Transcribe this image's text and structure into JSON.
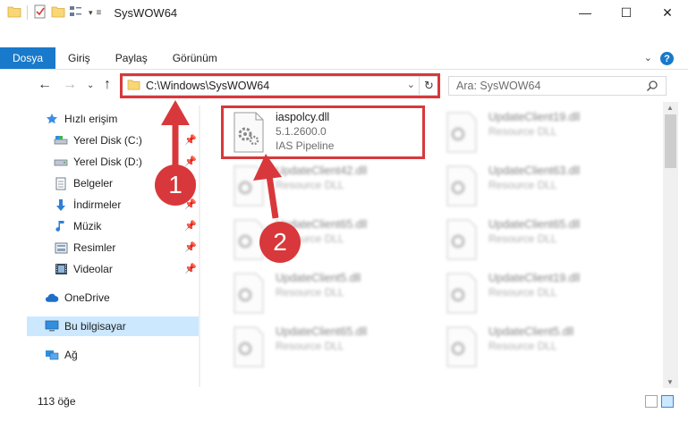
{
  "window": {
    "title": "SysWOW64",
    "controls": [
      "—",
      "☐",
      "✕"
    ]
  },
  "ribbon": {
    "tabs": [
      {
        "label": "Dosya",
        "active": true
      },
      {
        "label": "Giriş"
      },
      {
        "label": "Paylaş"
      },
      {
        "label": "Görünüm"
      }
    ],
    "help": "?"
  },
  "navbar": {
    "address": "C:\\Windows\\SysWOW64",
    "search_placeholder": "Ara: SysWOW64"
  },
  "sidebar": {
    "items": [
      {
        "label": "Hızlı erişim",
        "icon": "star-icon"
      },
      {
        "label": "Yerel Disk (C:)",
        "icon": "drive-icon",
        "pinned": true
      },
      {
        "label": "Yerel Disk (D:)",
        "icon": "drive-icon",
        "pinned": true
      },
      {
        "label": "Belgeler",
        "icon": "document-icon",
        "pinned": true
      },
      {
        "label": "İndirmeler",
        "icon": "download-icon",
        "pinned": true
      },
      {
        "label": "Müzik",
        "icon": "music-icon",
        "pinned": true
      },
      {
        "label": "Resimler",
        "icon": "pictures-icon",
        "pinned": true
      },
      {
        "label": "Videolar",
        "icon": "video-icon",
        "pinned": true
      },
      {
        "label": "OneDrive",
        "icon": "cloud-icon"
      },
      {
        "label": "Bu bilgisayar",
        "icon": "computer-icon",
        "selected": true
      },
      {
        "label": "Ağ",
        "icon": "network-icon"
      }
    ]
  },
  "files": [
    {
      "name": "iaspolcy.dll",
      "line2": "5.1.2600.0",
      "line3": "IAS Pipeline"
    },
    {
      "name": "UpdateClient19.dll",
      "line2": "Resource DLL"
    },
    {
      "name": "UpdateClient42.dll",
      "line2": "Resource DLL"
    },
    {
      "name": "UpdateClient63.dll",
      "line2": "Resource DLL"
    },
    {
      "name": "UpdateClient65.dll",
      "line2": "Resource DLL"
    },
    {
      "name": "UpdateClient65.dll",
      "line2": "Resource DLL"
    },
    {
      "name": "UpdateClient5.dll",
      "line2": "Resource DLL"
    },
    {
      "name": "UpdateClient19.dll",
      "line2": "Resource DLL"
    },
    {
      "name": "UpdateClient65.dll",
      "line2": "Resource DLL"
    },
    {
      "name": "UpdateClient5.dll",
      "line2": "Resource DLL"
    }
  ],
  "status": {
    "count": "113 öğe"
  },
  "annotations": {
    "badge1": "1",
    "badge2": "2",
    "color": "#d8383b"
  },
  "colors": {
    "accent": "#1979ca",
    "selection": "#cce8ff"
  }
}
